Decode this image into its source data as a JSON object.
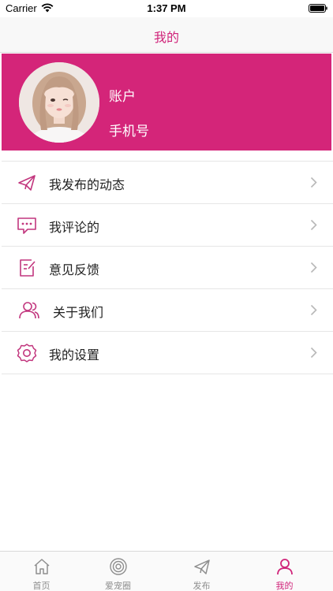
{
  "status_bar": {
    "carrier": "Carrier",
    "time": "1:37 PM"
  },
  "nav": {
    "title": "我的"
  },
  "profile": {
    "account_label": "账户",
    "phone_label": "手机号"
  },
  "menu": {
    "items": [
      {
        "label": "我发布的动态",
        "icon": "paper-plane-icon"
      },
      {
        "label": "我评论的",
        "icon": "comment-icon"
      },
      {
        "label": "意见反馈",
        "icon": "feedback-icon"
      },
      {
        "label": "关于我们",
        "icon": "users-icon"
      },
      {
        "label": "我的设置",
        "icon": "gear-icon"
      }
    ]
  },
  "tabs": {
    "items": [
      {
        "label": "首页",
        "icon": "home-icon",
        "active": false
      },
      {
        "label": "爱宠圈",
        "icon": "target-icon",
        "active": false
      },
      {
        "label": "发布",
        "icon": "paper-plane-icon",
        "active": false
      },
      {
        "label": "我的",
        "icon": "person-icon",
        "active": true
      }
    ]
  },
  "colors": {
    "accent": "#d42579",
    "icon_accent": "#c2367e",
    "text_primary": "#222222",
    "tab_inactive": "#8e8e8e"
  }
}
